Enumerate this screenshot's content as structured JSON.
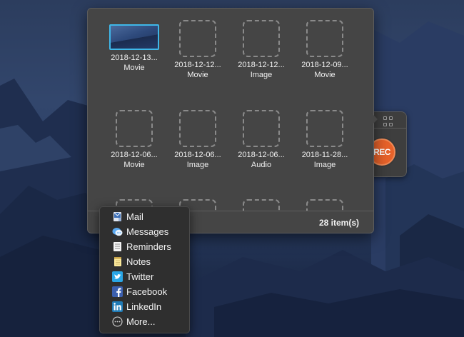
{
  "panel": {
    "items": [
      {
        "name": "2018-12-13...",
        "type": "Movie",
        "selected": true
      },
      {
        "name": "2018-12-12...",
        "type": "Movie"
      },
      {
        "name": "2018-12-12...",
        "type": "Image"
      },
      {
        "name": "2018-12-09...",
        "type": "Movie"
      },
      {
        "name": "2018-12-06...",
        "type": "Movie"
      },
      {
        "name": "2018-12-06...",
        "type": "Image"
      },
      {
        "name": "2018-12-06...",
        "type": "Audio"
      },
      {
        "name": "2018-11-28...",
        "type": "Image"
      }
    ],
    "count_label": "28 item(s)"
  },
  "recorder": {
    "rec_label": "REC",
    "accent_color": "#e8622a"
  },
  "share_menu": {
    "items": [
      {
        "label": "Mail",
        "icon": "mail-icon"
      },
      {
        "label": "Messages",
        "icon": "messages-icon"
      },
      {
        "label": "Reminders",
        "icon": "reminders-icon"
      },
      {
        "label": "Notes",
        "icon": "notes-icon"
      },
      {
        "label": "Twitter",
        "icon": "twitter-icon"
      },
      {
        "label": "Facebook",
        "icon": "facebook-icon"
      },
      {
        "label": "LinkedIn",
        "icon": "linkedin-icon"
      },
      {
        "label": "More...",
        "icon": "more-icon"
      }
    ]
  },
  "colors": {
    "selection": "#3fb7e8",
    "panel_bg": "#454545",
    "menu_bg": "#2f2f2f"
  }
}
